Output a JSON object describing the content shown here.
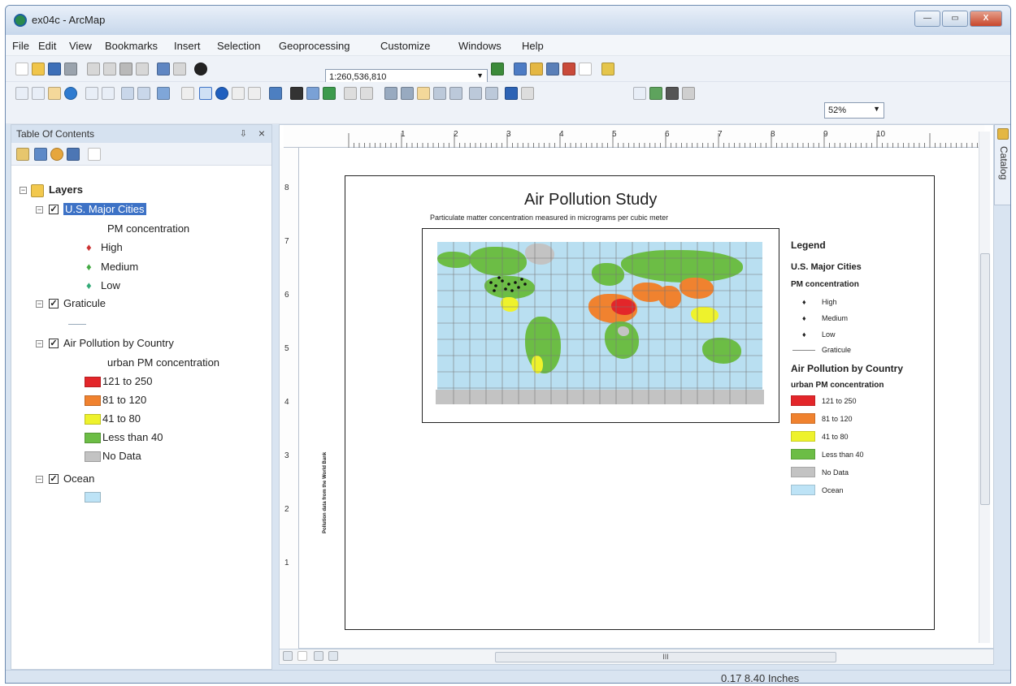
{
  "window": {
    "title": "ex04c - ArcMap",
    "minimize": "—",
    "maximize": "▭",
    "close": "X"
  },
  "menu": [
    "File",
    "Edit",
    "View",
    "Bookmarks",
    "Insert",
    "Selection",
    "Geoprocessing",
    "Customize",
    "Windows",
    "Help"
  ],
  "toolbar": {
    "scale_value": "1:260,536,810",
    "zoom_value": "52%"
  },
  "toc": {
    "title": "Table Of Contents",
    "pin": "⇩",
    "close": "×",
    "layers_label": "Layers",
    "cities_layer": "U.S. Major Cities",
    "cities_field": "PM concentration",
    "cities_classes": [
      "High",
      "Medium",
      "Low"
    ],
    "graticule_layer": "Graticule",
    "country_layer": "Air Pollution by Country",
    "country_field": "urban PM concentration",
    "country_classes": [
      "121 to 250",
      "81 to 120",
      "41 to 80",
      "Less than 40",
      "No Data"
    ],
    "ocean_layer": "Ocean"
  },
  "colors": {
    "high": "#e3262a",
    "mid_high": "#f0822f",
    "mid": "#eef22c",
    "low": "#6cbd45",
    "nodata": "#c3c3c3",
    "ocean": "#bde3f6"
  },
  "ruler": {
    "top": [
      "1",
      "2",
      "3",
      "4",
      "5",
      "6",
      "7",
      "8",
      "9",
      "10"
    ],
    "left": [
      "8",
      "7",
      "6",
      "5",
      "4",
      "3",
      "2",
      "1"
    ]
  },
  "layout": {
    "title": "Air Pollution Study",
    "subtitle": "Particulate matter concentration measured in micrograms per cubic meter",
    "credit": "Pollution data from the World Bank",
    "legend_title": "Legend",
    "legend_cities": "U.S. Major Cities",
    "legend_cities_field": "PM concentration",
    "legend_city_classes": [
      "High",
      "Medium",
      "Low"
    ],
    "legend_graticule": "Graticule",
    "legend_country": "Air Pollution by Country",
    "legend_country_field": "urban PM concentration",
    "legend_country_classes": [
      "121 to 250",
      "81 to 120",
      "41 to 80",
      "Less than 40",
      "No Data",
      "Ocean"
    ]
  },
  "hscroll_thumb": "III",
  "catalog_label": "Catalog",
  "status": {
    "coords": "0.17  8.40 Inches"
  }
}
